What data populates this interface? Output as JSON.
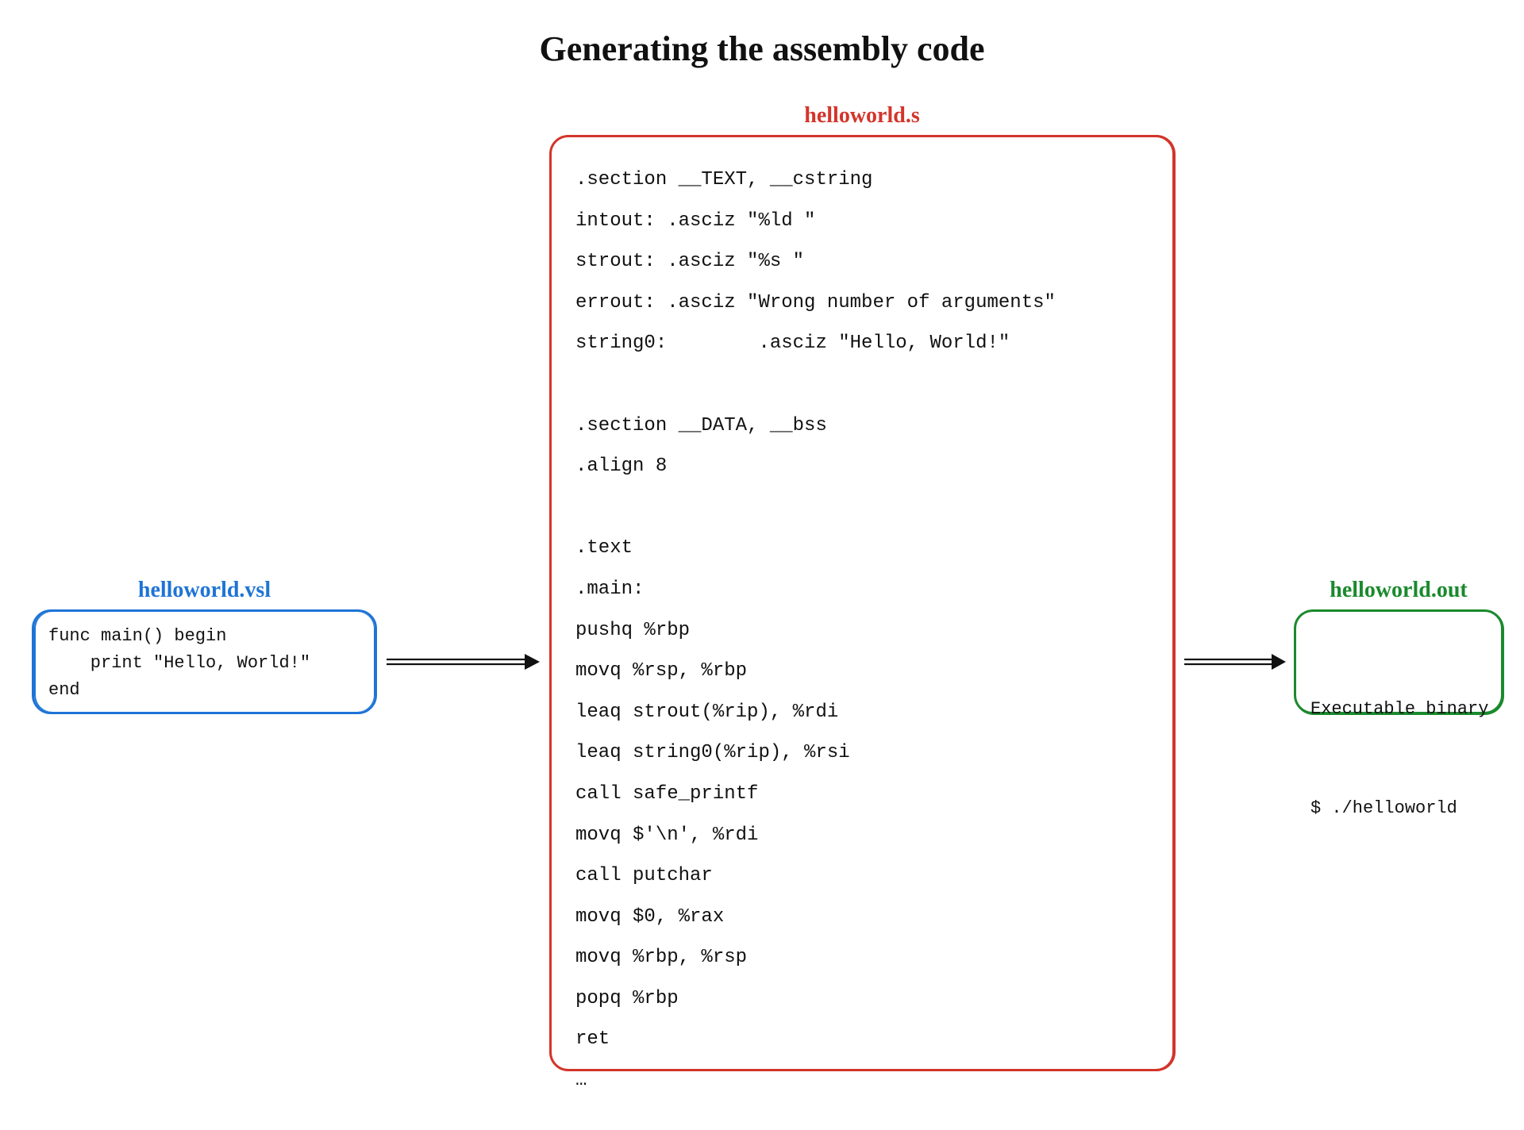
{
  "title": "Generating the assembly code",
  "source": {
    "label": "helloworld.vsl",
    "code": "func main() begin\n    print \"Hello, World!\"\nend"
  },
  "assembly": {
    "label": "helloworld.s",
    "code": ".section __TEXT, __cstring\nintout: .asciz \"%ld \"\nstrout: .asciz \"%s \"\nerrout: .asciz \"Wrong number of arguments\"\nstring0:        .asciz \"Hello, World!\"\n\n.section __DATA, __bss\n.align 8\n\n.text\n.main:\npushq %rbp\nmovq %rsp, %rbp\nleaq strout(%rip), %rdi\nleaq string0(%rip), %rsi\ncall safe_printf\nmovq $'\\n', %rdi\ncall putchar\nmovq $0, %rax\nmovq %rbp, %rsp\npopq %rbp\nret\n…"
  },
  "output": {
    "label": "helloworld.out",
    "line1": "Executable binary",
    "line2": "$ ./helloworld"
  },
  "colors": {
    "source": "#1e74d6",
    "assembly": "#d3352b",
    "output": "#1a8a2d",
    "text": "#111111"
  }
}
